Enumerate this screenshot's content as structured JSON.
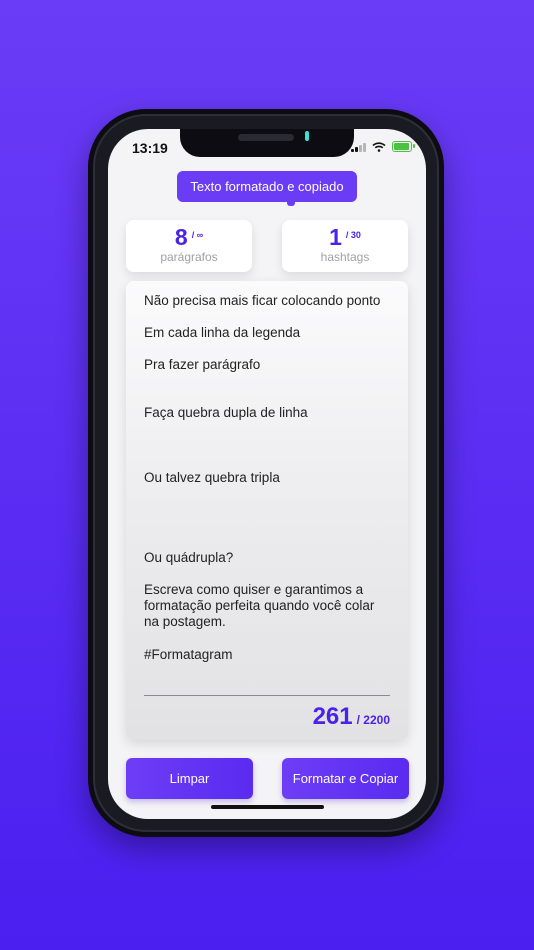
{
  "status_bar": {
    "time": "13:19"
  },
  "toast": {
    "text": "Texto formatado e copiado"
  },
  "stats": {
    "paragraphs": {
      "value": "8",
      "max": "/ ∞",
      "label": "parágrafos"
    },
    "hashtags": {
      "value": "1",
      "max": "/ 30",
      "label": "hashtags"
    }
  },
  "editor": {
    "lines": [
      "Não precisa mais ficar colocando ponto",
      "Em cada linha da legenda",
      "Pra fazer parágrafo",
      "Faça quebra dupla de linha",
      "Ou talvez quebra tripla",
      "Ou quádrupla?",
      "Escreva como quiser e garantimos a",
      "formatação perfeita quando você colar",
      "na postagem.",
      "#Formatagram"
    ],
    "char_count": "261",
    "char_max": "/ 2200"
  },
  "buttons": {
    "clear": "Limpar",
    "format_copy": "Formatar e Copiar"
  },
  "colors": {
    "accent": "#5a2bf0",
    "background": "#5f31f4"
  }
}
